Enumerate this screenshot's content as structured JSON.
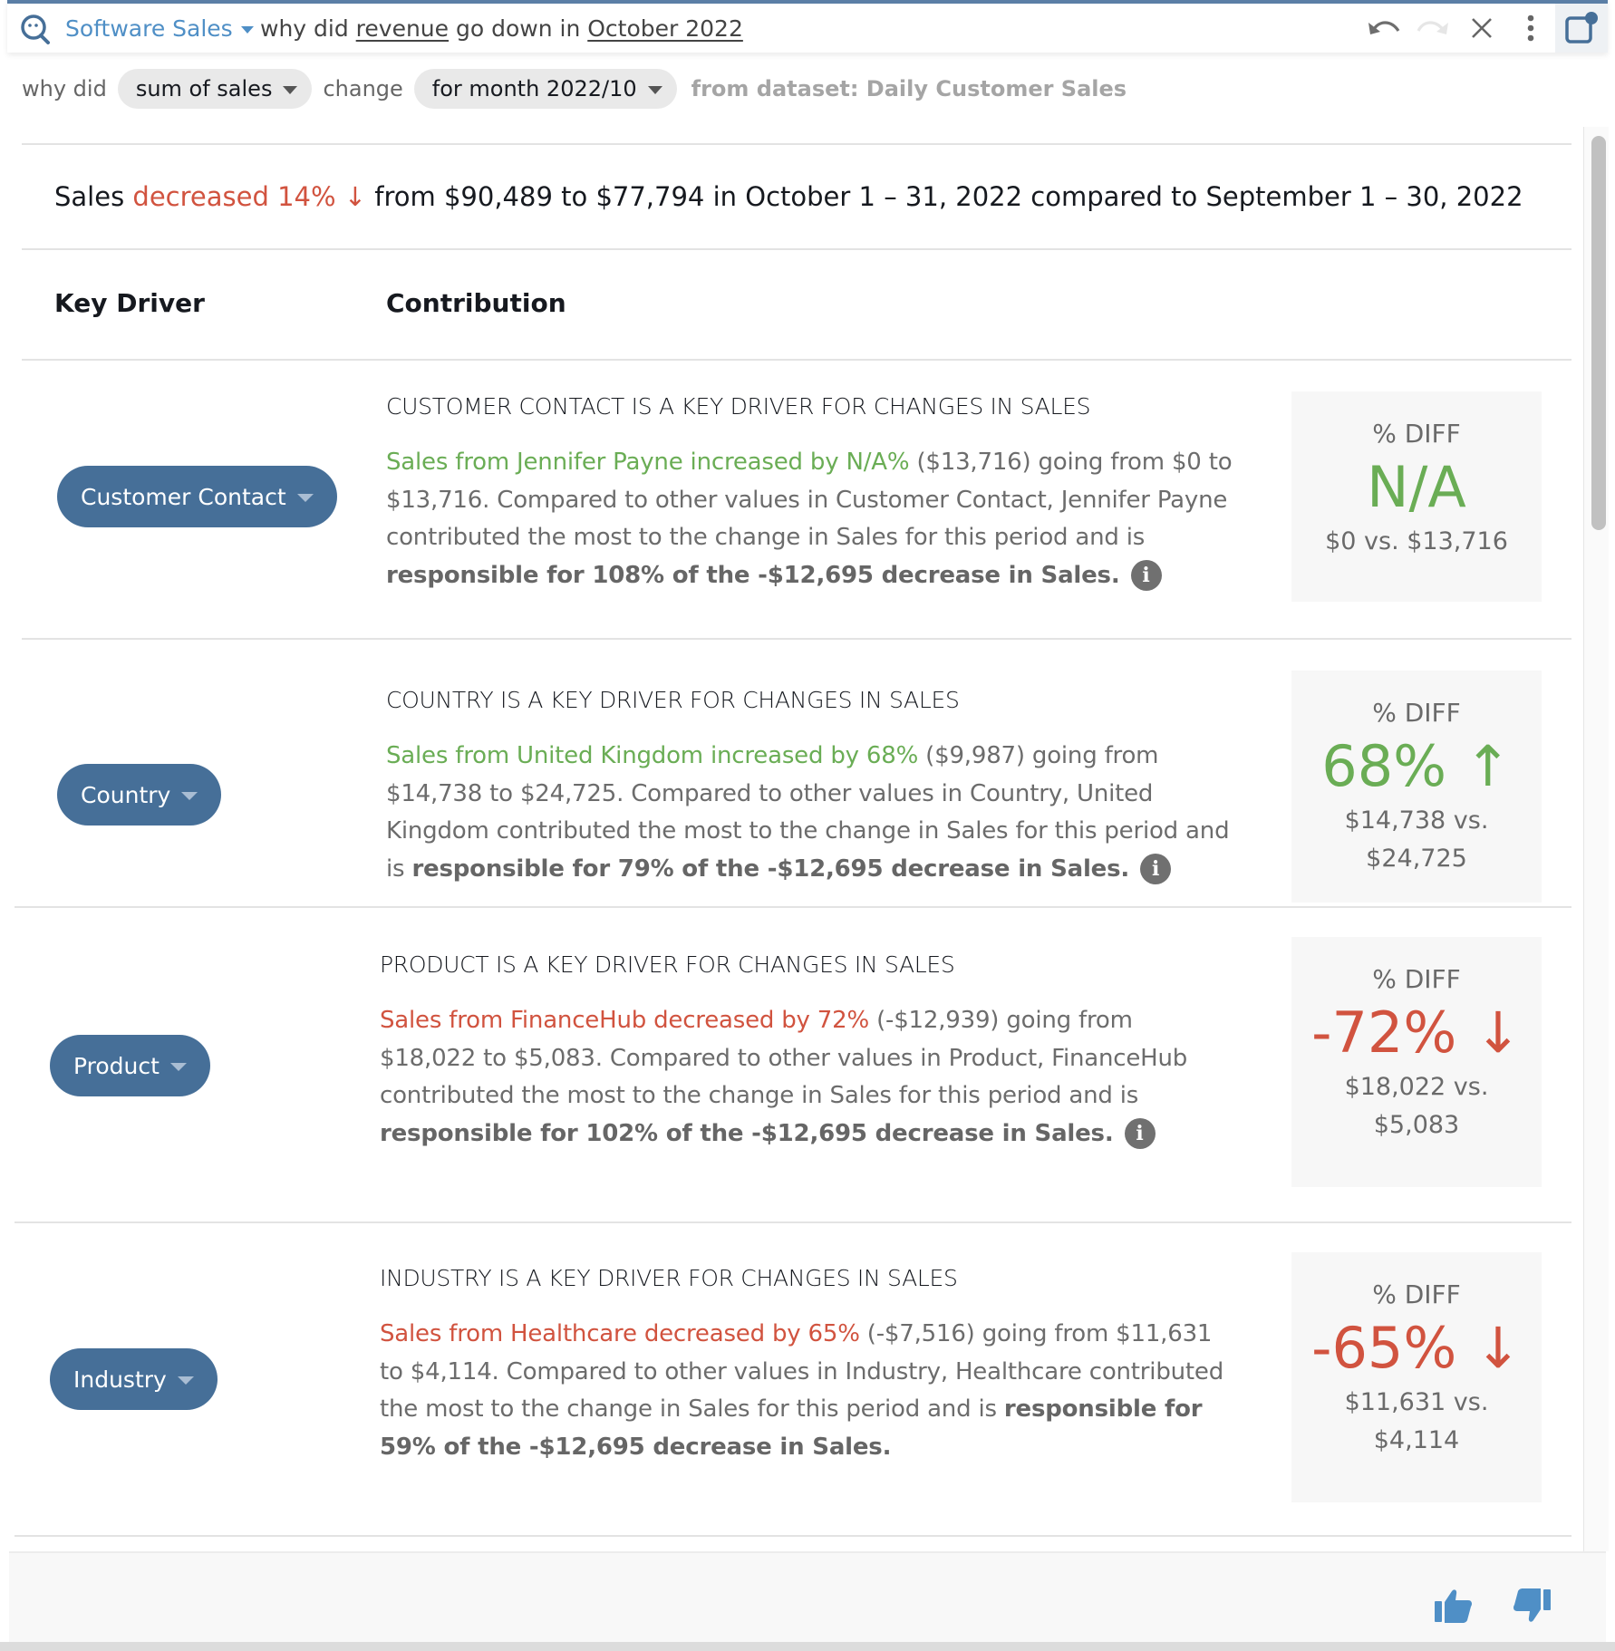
{
  "topbar": {
    "dataset": "Software Sales",
    "question": {
      "part1": "why did ",
      "term1": "revenue",
      "part2": " go down in ",
      "term2": "October 2022"
    },
    "icons": [
      "q-search-icon",
      "undo-icon",
      "redo-icon",
      "close-icon",
      "more-vertical-icon",
      "expand-window-icon"
    ]
  },
  "filters": {
    "prefix": "why did",
    "measure": "sum of sales",
    "middle": "change",
    "period": "for month 2022/10",
    "source": "from dataset: Daily Customer Sales"
  },
  "summary": {
    "lead": "Sales ",
    "change": "decreased 14% ↓",
    "rest": " from $90,489 to $77,794 in October 1 – 31, 2022 compared to September 1 – 30, 2022"
  },
  "columns": {
    "key_driver": "Key Driver",
    "contribution": "Contribution"
  },
  "drivers": [
    {
      "name": "Customer Contact",
      "title": "CUSTOMER CONTACT IS A KEY DRIVER FOR CHANGES IN SALES",
      "highlight": "Sales from Jennifer Payne increased by N/A%",
      "direction": "pos",
      "body": " ($13,716) going from $0 to $13,716. Compared to other values in Customer Contact, Jennifer Payne contributed the most to the change in Sales for this period and is ",
      "bold": "responsible for 108% of the -$12,695 decrease in Sales.",
      "has_info": true,
      "diff_label": "% DIFF",
      "diff_value": "N/A",
      "diff_compare": "$0 vs. $13,716"
    },
    {
      "name": "Country",
      "title": "COUNTRY IS A KEY DRIVER FOR CHANGES IN SALES",
      "highlight": "Sales from United Kingdom increased by 68%",
      "direction": "pos",
      "body": " ($9,987) going from $14,738 to $24,725. Compared to other values in Country, United Kingdom contributed the most to the change in Sales for this period and is ",
      "bold": "responsible for 79% of the -$12,695 decrease in Sales.",
      "has_info": true,
      "diff_label": "% DIFF",
      "diff_value": "68% ↑",
      "diff_compare": "$14,738 vs. $24,725"
    },
    {
      "name": "Product",
      "title": "PRODUCT IS A KEY DRIVER FOR CHANGES IN SALES",
      "highlight": "Sales from FinanceHub decreased by 72%",
      "direction": "neg",
      "body": " (-$12,939) going from $18,022 to $5,083. Compared to other values in Product, FinanceHub contributed the most to the change in Sales for this period and is ",
      "bold": "responsible for 102% of the -$12,695 decrease in Sales.",
      "has_info": true,
      "diff_label": "% DIFF",
      "diff_value": "-72% ↓",
      "diff_compare": "$18,022 vs. $5,083"
    },
    {
      "name": "Industry",
      "title": "INDUSTRY IS A KEY DRIVER FOR CHANGES IN SALES",
      "highlight": "Sales from Healthcare decreased by 65%",
      "direction": "neg",
      "body": " (-$7,516) going from $11,631 to $4,114. Compared to other values in Industry, Healthcare contributed the most to the change in Sales for this period and is ",
      "bold": "responsible for 59% of the -$12,695 decrease in Sales.",
      "has_info": false,
      "diff_label": "% DIFF",
      "diff_value": "-65% ↓",
      "diff_compare": "$11,631 vs. $4,114"
    }
  ],
  "info_glyph": "i",
  "footer": {
    "icons": [
      "thumbs-up-icon",
      "thumbs-down-icon"
    ]
  },
  "colors": {
    "positive": "#6aad55",
    "negative": "#d1533f",
    "pill": "#466f98",
    "accent": "#4f8fc6"
  }
}
